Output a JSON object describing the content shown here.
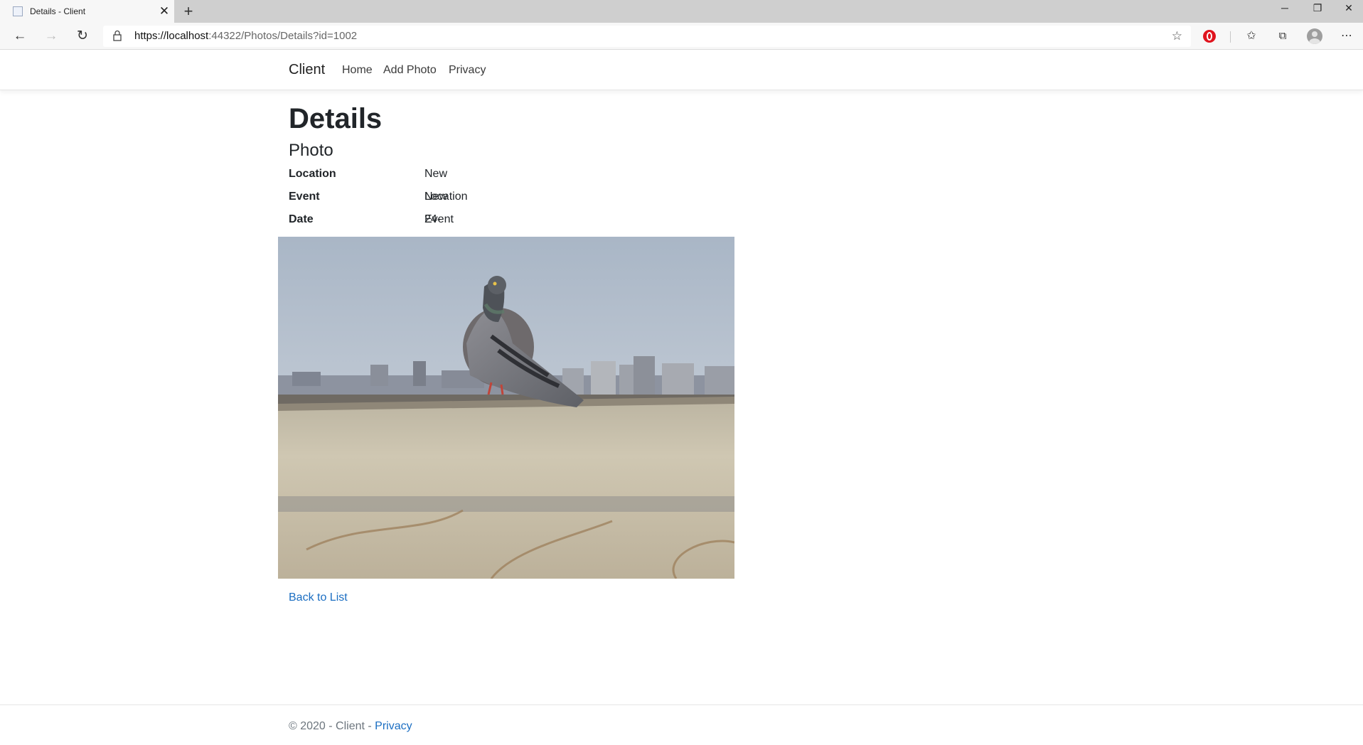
{
  "browser": {
    "tab_title": "Details - Client",
    "new_tab_icon": "plus-icon",
    "url_host": "https://localhost",
    "url_path": ":44322/Photos/Details?id=1002",
    "window_controls": [
      "minimize-icon",
      "restore-icon",
      "close-icon"
    ]
  },
  "navbar": {
    "brand": "Client",
    "links": [
      "Home",
      "Add Photo",
      "Privacy"
    ]
  },
  "main": {
    "title": "Details",
    "subtitle": "Photo",
    "fields": [
      {
        "label": "Location",
        "value": "New Location"
      },
      {
        "label": "Event",
        "value": "New Event"
      },
      {
        "label": "Date",
        "value": "24-02-2020"
      }
    ],
    "back_link": "Back to List"
  },
  "footer": {
    "copyright": "© 2020 - Client - ",
    "privacy_link": "Privacy"
  },
  "colors": {
    "link": "#1b6ec2",
    "opera_red": "#e0141e"
  }
}
